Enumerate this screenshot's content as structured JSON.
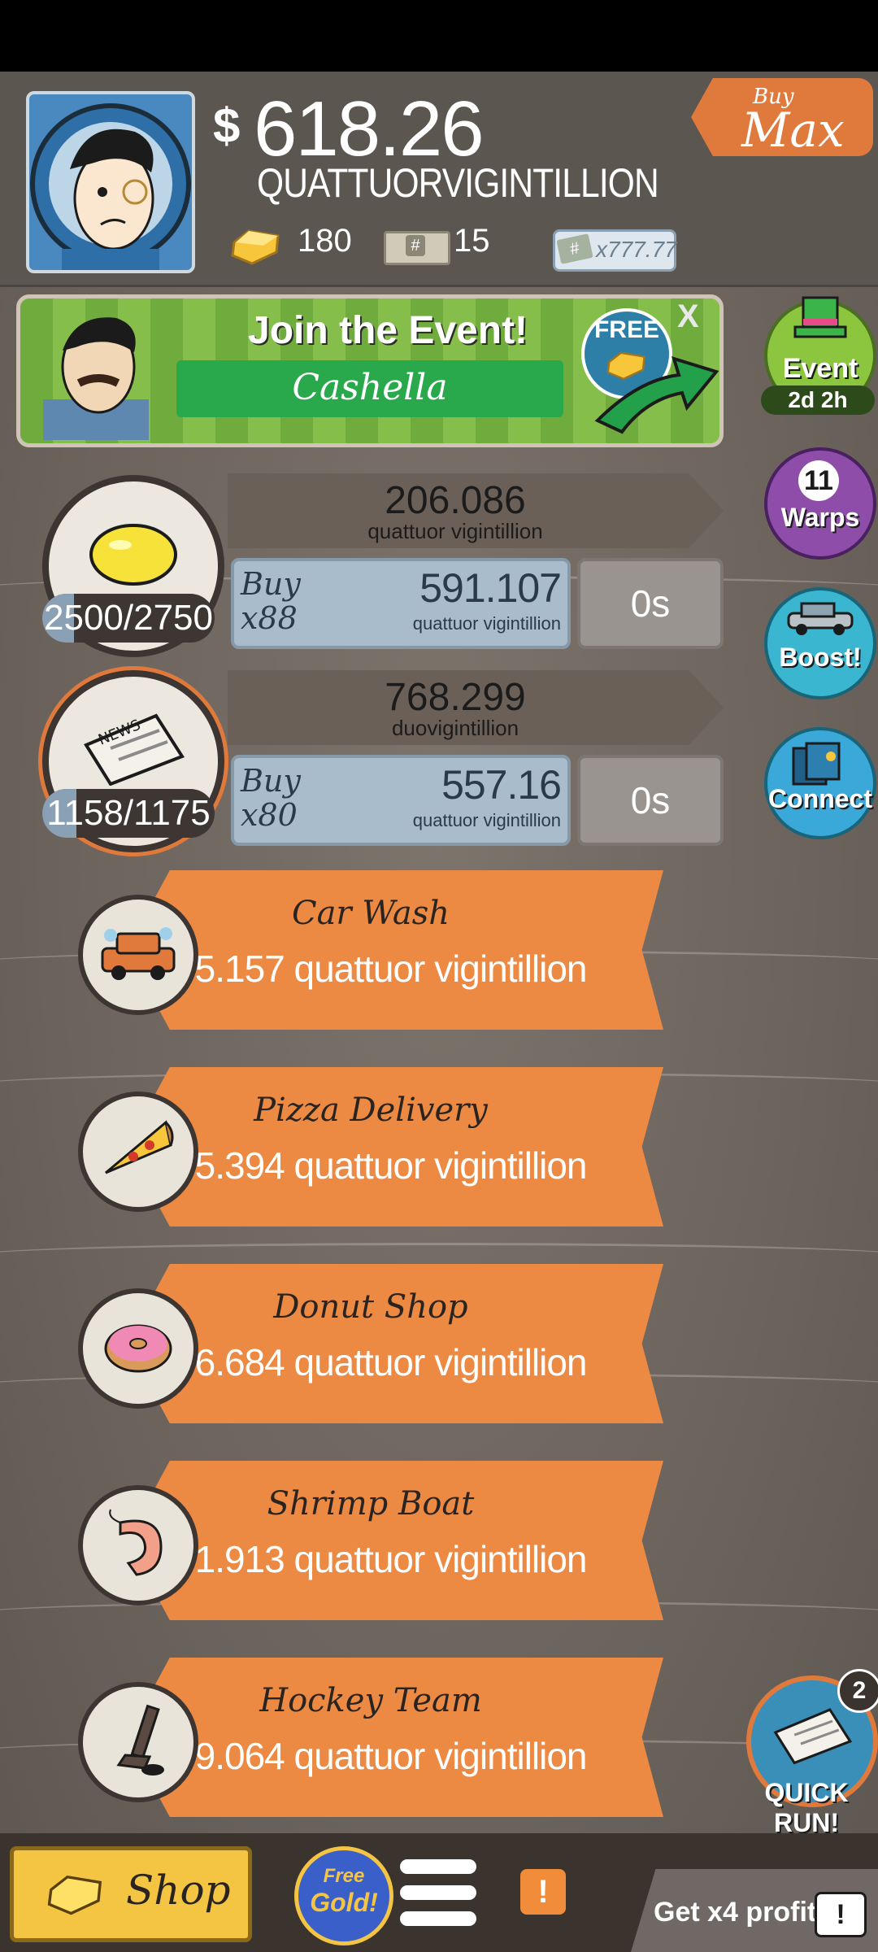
{
  "header": {
    "currency_symbol": "$",
    "money_value": "618.26",
    "money_unit": "QUATTUORVIGINTILLION",
    "gold_count": "180",
    "megabucks_count": "15",
    "multiplier_label": "x777.77",
    "buy_max_top": "Buy",
    "buy_max_bottom": "Max"
  },
  "event_banner": {
    "title": "Join the Event!",
    "event_name": "Cashella",
    "free_label": "FREE",
    "close_label": "X"
  },
  "side_buttons": {
    "event_label": "Event",
    "event_timer": "2d 2h",
    "warps_count": "11",
    "warps_label": "Warps",
    "boost_label": "Boost!",
    "connect_label": "Connect"
  },
  "owned_businesses": [
    {
      "icon": "lemon-icon",
      "count": "2500/2750",
      "revenue_value": "206.086",
      "revenue_unit": "quattuor vigintillion",
      "buy_label": "Buy",
      "buy_qty": "x88",
      "cost_value": "591.107",
      "cost_unit": "quattuor vigintillion",
      "timer": "0s",
      "progress": 0.909
    },
    {
      "icon": "newspaper-icon",
      "count": "1158/1175",
      "revenue_value": "768.299",
      "revenue_unit": "duovigintillion",
      "buy_label": "Buy",
      "buy_qty": "x80",
      "cost_value": "557.16",
      "cost_unit": "quattuor vigintillion",
      "timer": "0s",
      "progress": 0.985
    }
  ],
  "unlockable_businesses": [
    {
      "name": "Car Wash",
      "cost": "555.157 quattuor vigintillion",
      "icon": "car-icon"
    },
    {
      "name": "Pizza Delivery",
      "cost": "565.394 quattuor vigintillion",
      "icon": "pizza-icon"
    },
    {
      "name": "Donut Shop",
      "cost": "556.684 quattuor vigintillion",
      "icon": "donut-icon"
    },
    {
      "name": "Shrimp Boat",
      "cost": "571.913 quattuor vigintillion",
      "icon": "shrimp-icon"
    },
    {
      "name": "Hockey Team",
      "cost": "569.064 quattuor vigintillion",
      "icon": "hockey-icon"
    }
  ],
  "quick_run": {
    "label": "QUICK RUN!",
    "badge_count": "2"
  },
  "bottom_bar": {
    "shop_label": "Shop",
    "free_gold_top": "Free",
    "free_gold_bottom": "Gold!",
    "alert_label": "!",
    "profit_label": "Get x4 profit!"
  },
  "colors": {
    "ribbon_orange": "#ec8a44",
    "buy_max_orange": "#e07a3c",
    "buy_box_blue": "#a9bccb",
    "event_green": "#7fb844",
    "shop_yellow": "#f4c542"
  }
}
